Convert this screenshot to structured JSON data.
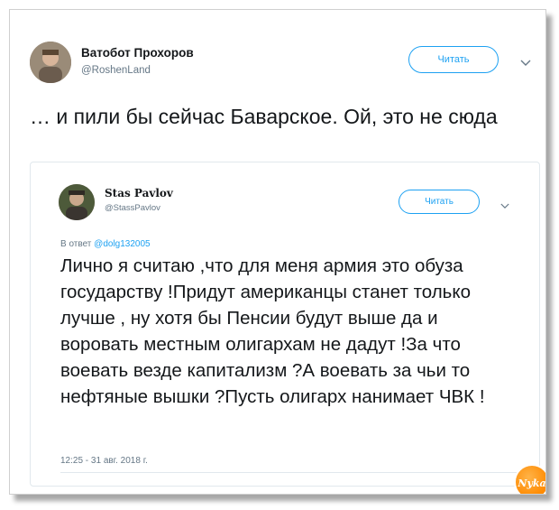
{
  "main_tweet": {
    "author_name": "Ватобот Прохоров",
    "author_handle": "@RoshenLand",
    "follow_label": "Читать",
    "text": "… и пили бы сейчас Баварское. Ой, это не сюда"
  },
  "quoted_tweet": {
    "author_name": "Stas Pavlov",
    "author_handle": "@StassPavlov",
    "follow_label": "Читать",
    "reply_prefix": "В ответ",
    "reply_handle": "@dolg132005",
    "text": "Лично я считаю ,что для меня армия это обуза государству !Придут американцы станет только лучше , ну хотя бы  Пенсии будут выше да и воровать местным олигархам не дадут !За что воевать везде капитализм ?А воевать за чьи то нефтяные вышки ?Пусть олигарх нанимает ЧВК !",
    "timestamp": "12:25 - 31 авг. 2018 г."
  },
  "icons": {
    "chevron": "chevron-down-icon",
    "watermark": "watermark-logo"
  },
  "watermark_text": "Nyka",
  "colors": {
    "accent": "#1da1f2",
    "text": "#14171a",
    "muted": "#657786",
    "border": "#e1e8ed",
    "watermark": "#ff8a00"
  }
}
